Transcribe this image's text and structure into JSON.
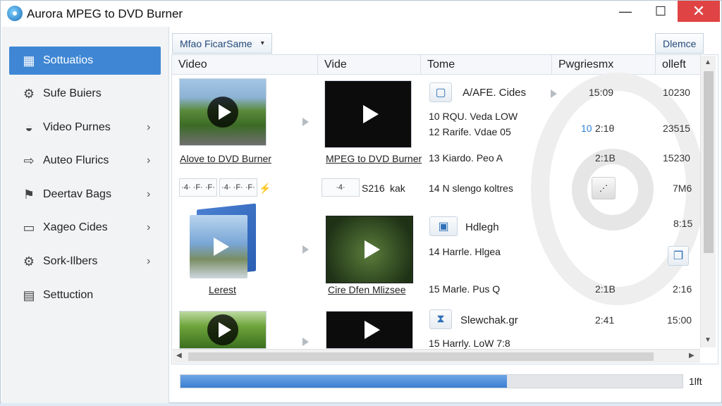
{
  "window": {
    "title": "Aurora MPEG to DVD Burner",
    "min": "—",
    "max": "☐",
    "close": "✕"
  },
  "sidebar": {
    "items": [
      {
        "label": "Sottuatios",
        "icon": "grid-icon",
        "glyph": "▦",
        "active": true,
        "chevron": ""
      },
      {
        "label": "Sufe Buiers",
        "icon": "gear-icon",
        "glyph": "⚙",
        "active": false,
        "chevron": ""
      },
      {
        "label": "Video Purnes",
        "icon": "disc-icon",
        "glyph": "◒",
        "active": false,
        "chevron": "›"
      },
      {
        "label": "Auteo Flurics",
        "icon": "export-icon",
        "glyph": "⇨",
        "active": false,
        "chevron": "›"
      },
      {
        "label": "Deertav Bags",
        "icon": "flag-icon",
        "glyph": "⚑",
        "active": false,
        "chevron": "›"
      },
      {
        "label": "Xageo Cides",
        "icon": "monitor-icon",
        "glyph": "▭",
        "active": false,
        "chevron": "›"
      },
      {
        "label": "Sork-Ilbers",
        "icon": "cog-icon",
        "glyph": "⚙",
        "active": false,
        "chevron": "›"
      },
      {
        "label": "Settuction",
        "icon": "document-icon",
        "glyph": "▤",
        "active": false,
        "chevron": ""
      }
    ]
  },
  "toolbar": {
    "left_label": "Mfao FicarSame",
    "right_label": "Dlemce",
    "caret": "▾"
  },
  "columns": [
    "Video",
    "Vide",
    "Tome",
    "Pwgriesmx",
    "olleft"
  ],
  "rows": {
    "r1": {
      "src_caption": "Alove to DVD Burner",
      "dst_caption": "MPEG to DVD Burner",
      "title_line": "A/AFE. Cides",
      "line_a": "10  RQU.  Veda   LOW",
      "line_b": "12  Rarife.   Vdae   05",
      "line_c": "13  Kiardo.     Peo     A",
      "p1": "15:09",
      "p2_prefix": "10",
      "p2": "2:1θ",
      "p3": "2:1B",
      "r1": "10230",
      "r2": "23515",
      "r3": "15230"
    },
    "r2": {
      "box1": "·4· ·F· ·F·",
      "box2": "·4·",
      "box2_text": "S216",
      "box2_tail": "kak",
      "line": "14  N slengo koltres",
      "right": "7M6"
    },
    "r3": {
      "src_caption": "Lerest",
      "dst_caption": "Cire Dfen Mlizsee",
      "title_line": "Hdlegh",
      "line_a": "14  Harrle.  Hlgea",
      "line_b": "15  Marle.     Pus     Q",
      "right1": "8:15",
      "p": "2:1B",
      "right2": "2:16"
    },
    "r4": {
      "title_line": "Slewchak.gr",
      "line_a": "15  Harrly.  LoW   7:8",
      "p": "2:41",
      "right": "15:00"
    }
  },
  "progress": {
    "value": 0.65,
    "label": "1lft"
  },
  "scroll": {
    "up": "▲",
    "down": "▼",
    "left": "◀",
    "right": "▶"
  }
}
